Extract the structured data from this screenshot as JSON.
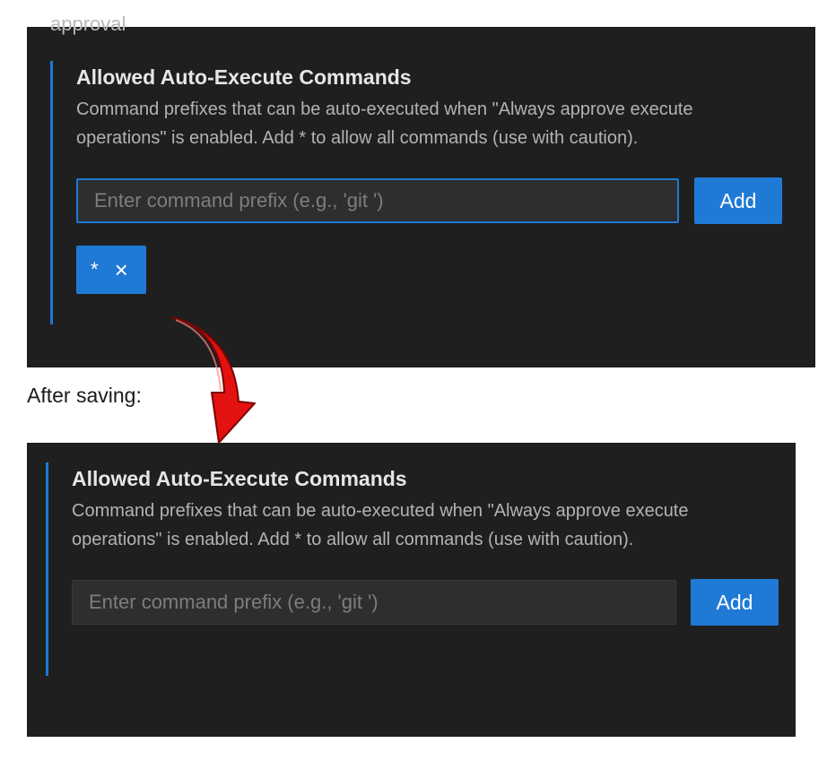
{
  "before": {
    "cut_heading": "approval",
    "section": {
      "title": "Allowed Auto-Execute Commands",
      "description": "Command prefixes that can be auto-executed when \"Always approve execute operations\" is enabled. Add * to allow all commands (use with caution).",
      "input_placeholder": "Enter command prefix (e.g., 'git ')",
      "add_label": "Add",
      "chips": [
        {
          "text": "*",
          "remove": "×"
        }
      ]
    }
  },
  "caption": "After saving:",
  "after": {
    "section": {
      "title": "Allowed Auto-Execute Commands",
      "description": "Command prefixes that can be auto-executed when \"Always approve execute operations\" is enabled. Add * to allow all commands (use with caution).",
      "input_placeholder": "Enter command prefix (e.g., 'git ')",
      "add_label": "Add"
    }
  },
  "colors": {
    "panel_bg": "#1f1f1f",
    "accent": "#1f7ad6",
    "arrow": "#e3110f"
  },
  "icons": {
    "arrow": "curved-down-arrow-icon",
    "chip_remove": "close-icon"
  }
}
